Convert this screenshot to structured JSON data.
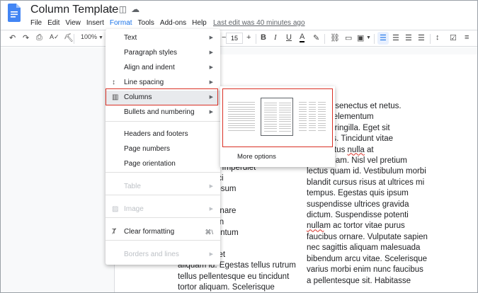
{
  "document": {
    "title": "Column Template",
    "last_edit": "Last edit was 40 minutes ago"
  },
  "menubar": {
    "items": [
      "File",
      "Edit",
      "View",
      "Insert",
      "Format",
      "Tools",
      "Add-ons",
      "Help"
    ],
    "active": "Format"
  },
  "toolbar": {
    "zoom": "100%",
    "font_size": "15"
  },
  "format_menu": {
    "items": [
      {
        "label": "Text",
        "submenu": true
      },
      {
        "label": "Paragraph styles",
        "submenu": true
      },
      {
        "label": "Align and indent",
        "submenu": true
      },
      {
        "label": "Line spacing",
        "submenu": true,
        "icon": "line-spacing-icon"
      },
      {
        "label": "Columns",
        "submenu": true,
        "icon": "columns-icon",
        "highlighted": true
      },
      {
        "label": "Bullets and numbering",
        "submenu": true
      },
      {
        "label": "Headers and footers"
      },
      {
        "label": "Page numbers"
      },
      {
        "label": "Page orientation"
      },
      {
        "label": "Table",
        "submenu": true,
        "disabled": true
      },
      {
        "label": "Image",
        "submenu": true,
        "disabled": true,
        "icon": "image-icon"
      },
      {
        "label": "Clear formatting",
        "icon": "clear-formatting-icon",
        "shortcut": "⌘\\"
      },
      {
        "label": "Borders and lines",
        "submenu": true,
        "disabled": true
      }
    ]
  },
  "columns_submenu": {
    "options": [
      "one-column",
      "two-columns",
      "three-columns"
    ],
    "selected": "two-columns",
    "more_options": "More options"
  },
  "body": {
    "right_column": [
      "ristique senectus et netus.",
      "aesent elementum",
      "leo vel fringilla. Eget sit",
      "llus cras. Tincidunt vitae",
      "quis lectus nulla at",
      "ctetur diam. Nisl vel pretium",
      "lectus quam id. Vestibulum morbi",
      "blandit cursus risus at ultrices mi",
      "tempus. Egestas quis ipsum",
      "suspendisse ultrices gravida",
      "dictum. Suspendisse potenti",
      "nullam ac tortor vitae purus",
      "faucibus ornare. Vulputate sapien",
      "nec sagittis aliquam malesuada",
      "bibendum arcu vitae. Scelerisque",
      "varius morbi enim nunc faucibus",
      "a pellentesque sit. Habitasse"
    ],
    "left_column": [
      "n leo vel orci",
      "ar. Lorem ipsum",
      "onsectetur",
      "aliquam. Ornare",
      "st placerat in",
      "tor condimentum",
      "ros donec.",
      "retra sit amet",
      "aliquam id. Egestas tellus rutrum",
      "tellus pellentesque eu tincidunt",
      "tortor aliquam. Scelerisque"
    ],
    "left_column_first": ". Imperdiet"
  },
  "colors": {
    "accent": "#1a73e8",
    "highlight_border": "#d93025"
  }
}
